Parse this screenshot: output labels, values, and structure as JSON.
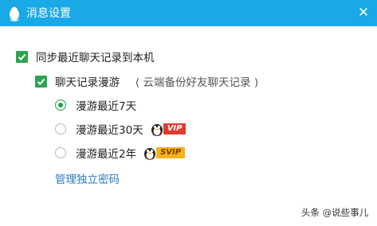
{
  "window": {
    "title": "消息设置",
    "close_symbol": "✕"
  },
  "options": {
    "sync_recent": {
      "label": "同步最近聊天记录到本机",
      "checked": true
    },
    "roaming": {
      "label": "聊天记录漫游",
      "hint": "( 云端备份好友聊天记录 )",
      "checked": true
    },
    "roaming_choices": [
      {
        "label": "漫游最近7天",
        "selected": true,
        "badge": ""
      },
      {
        "label": "漫游最近30天",
        "selected": false,
        "badge": "VIP"
      },
      {
        "label": "漫游最近2年",
        "selected": false,
        "badge": "SVIP"
      }
    ]
  },
  "manage_password_link": "管理独立密码",
  "watermark": "头条 @说些事儿",
  "colors": {
    "titlebar": "#19a9e7",
    "check": "#2ea44f",
    "link": "#2a79c3",
    "vip": "#e2392f",
    "svip": "#f5b21b"
  }
}
